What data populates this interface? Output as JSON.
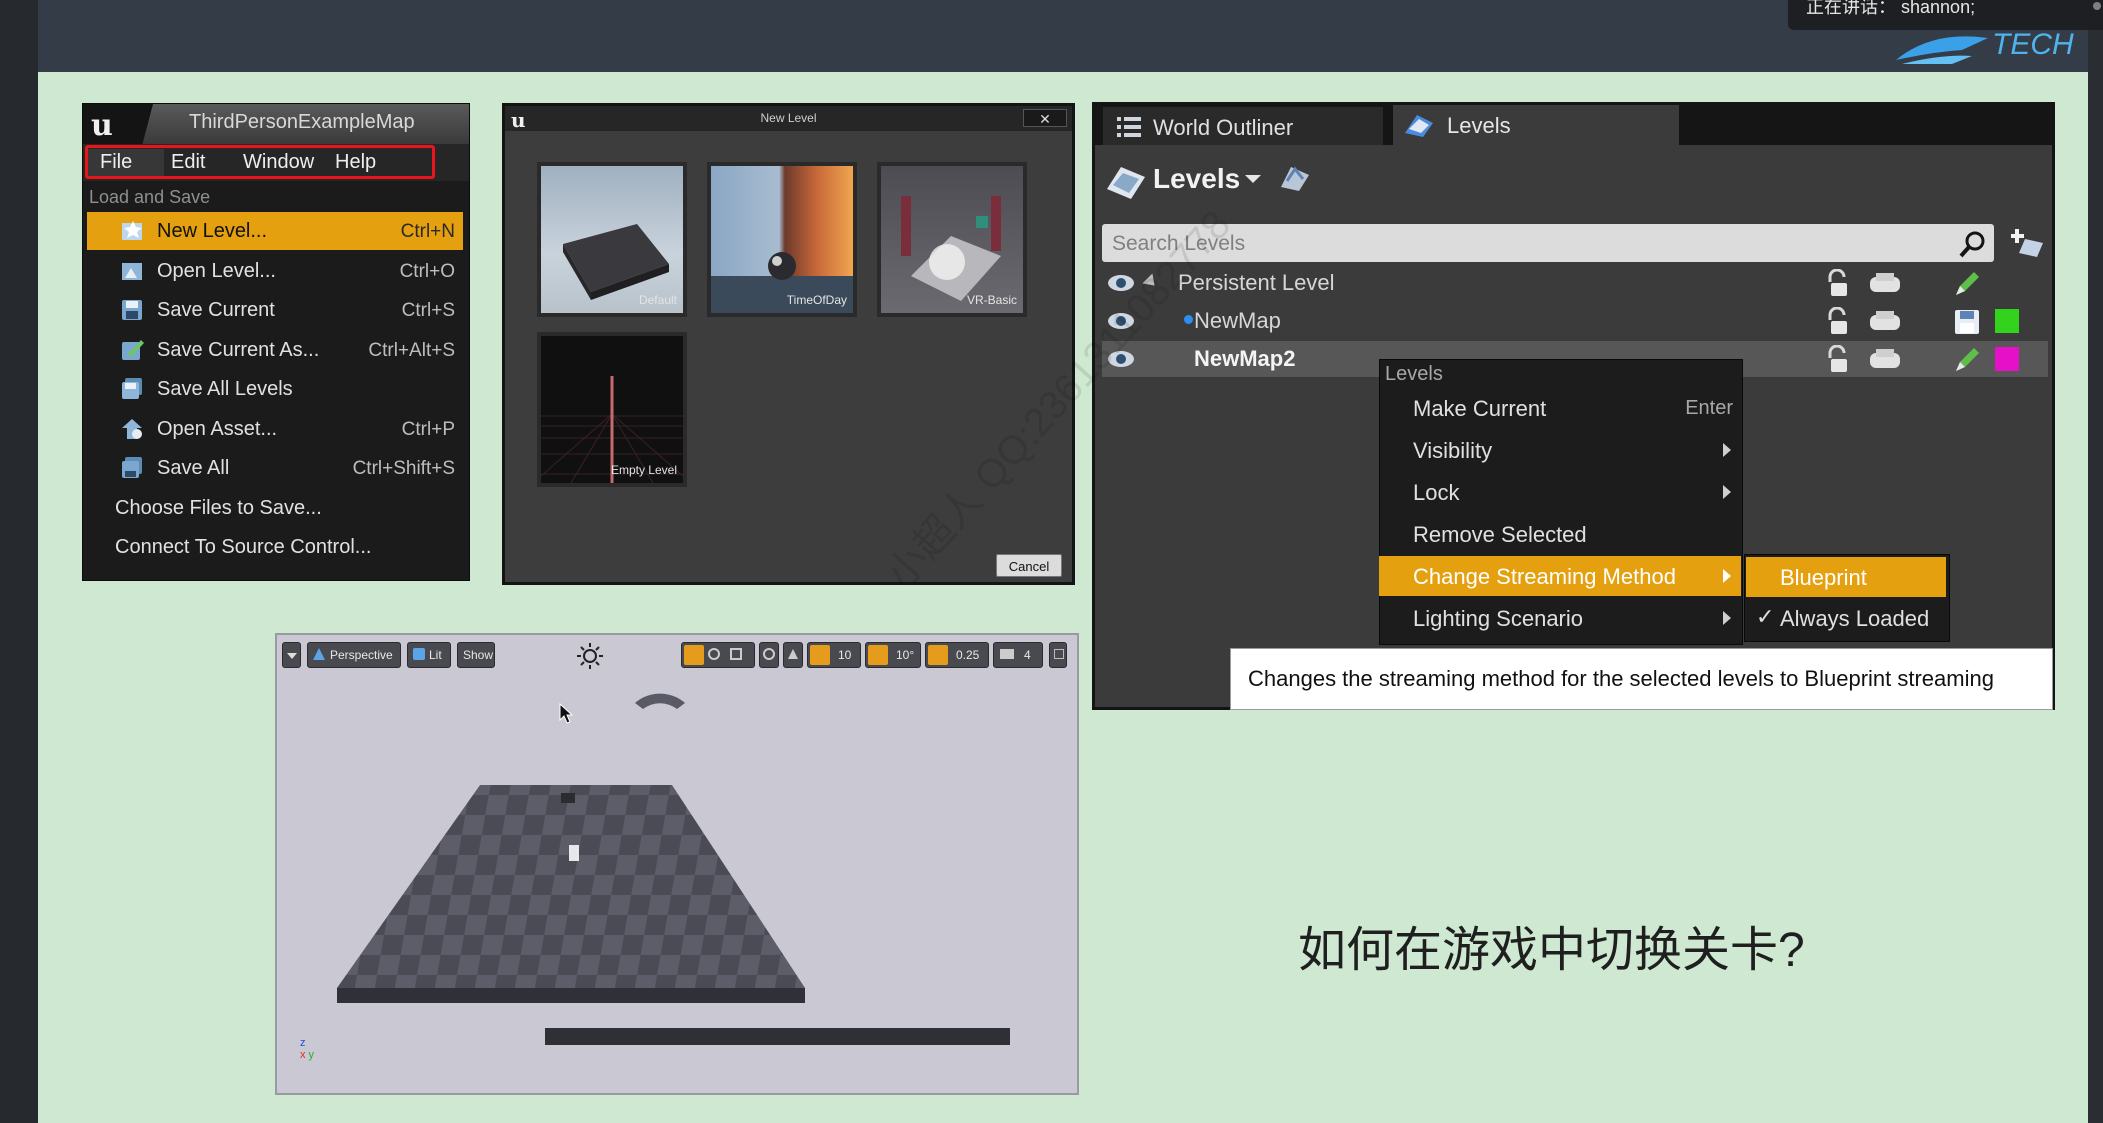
{
  "overlay": {
    "speaking_label": "正在讲话：",
    "speaking_name": "shannon;",
    "brand_text": "TECH"
  },
  "file_menu": {
    "window_title": "ThirdPersonExampleMap",
    "menubar": [
      "File",
      "Edit",
      "Window",
      "Help"
    ],
    "section": "Load and Save",
    "items": [
      {
        "label": "New Level...",
        "shortcut": "Ctrl+N",
        "highlighted": true,
        "icon": "new-level-icon"
      },
      {
        "label": "Open Level...",
        "shortcut": "Ctrl+O",
        "icon": "open-level-icon"
      },
      {
        "label": "Save Current",
        "shortcut": "Ctrl+S",
        "icon": "save-icon"
      },
      {
        "label": "Save Current As...",
        "shortcut": "Ctrl+Alt+S",
        "icon": "save-as-icon"
      },
      {
        "label": "Save All Levels",
        "shortcut": "",
        "icon": "save-all-levels-icon"
      },
      {
        "label": "Open Asset...",
        "shortcut": "Ctrl+P",
        "icon": "open-asset-icon"
      },
      {
        "label": "Save All",
        "shortcut": "Ctrl+Shift+S",
        "icon": "save-all-icon"
      },
      {
        "label": "Choose Files to Save...",
        "shortcut": ""
      },
      {
        "label": "Connect To Source Control...",
        "shortcut": ""
      }
    ],
    "highlight_color": "#e5a00f"
  },
  "new_level_dialog": {
    "title": "New Level",
    "close": "✕",
    "templates": [
      "Default",
      "TimeOfDay",
      "VR-Basic",
      "Empty Level"
    ],
    "cancel": "Cancel"
  },
  "levels_panel": {
    "tabs": [
      "World Outliner",
      "Levels"
    ],
    "header": "Levels",
    "search_placeholder": "Search Levels",
    "rows": [
      "Persistent Level",
      "NewMap",
      "NewMap2"
    ],
    "row_colors": [
      "",
      "#33d21c",
      "#e510c8"
    ],
    "context_menu": {
      "heading": "Levels",
      "items": [
        "Make Current",
        "Visibility",
        "Lock",
        "Remove Selected",
        "Change Streaming Method",
        "Lighting Scenario"
      ],
      "make_current_shortcut": "Enter"
    },
    "submenu": {
      "items": [
        "Blueprint",
        "Always Loaded"
      ],
      "checked": "Always Loaded"
    },
    "tooltip": "Changes the streaming method for the selected levels to Blueprint streaming"
  },
  "viewport": {
    "toolbar": {
      "perspective": "Perspective",
      "lit": "Lit",
      "show": "Show",
      "grid_snap": "10",
      "rotation_snap": "10°",
      "scale_snap": "0.25",
      "camera_speed": "4"
    }
  },
  "watermark": "小超人 QQ:2361311082778",
  "question": "如何在游戏中切换关卡?"
}
